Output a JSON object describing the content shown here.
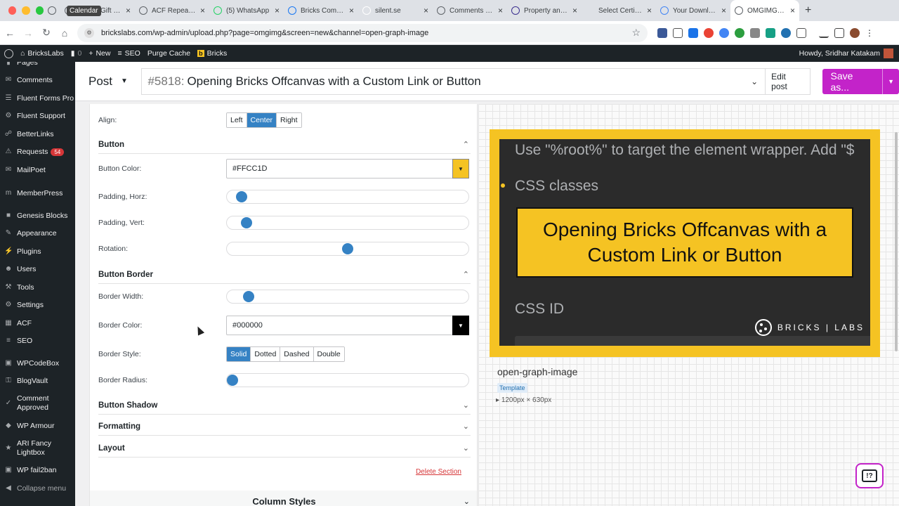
{
  "browser": {
    "tooltip": "Calendar",
    "tabs": [
      {
        "title": "",
        "width": 24
      },
      {
        "title": "Your E-Gift Car",
        "width": 106
      },
      {
        "title": "ACF Repeater F",
        "width": 106
      },
      {
        "title": "(5) WhatsApp",
        "width": 106
      },
      {
        "title": "Bricks Commun",
        "width": 106
      },
      {
        "title": "silent.se",
        "width": 106
      },
      {
        "title": "Comments ‹ Bri",
        "width": 106
      },
      {
        "title": "Property and p",
        "width": 106
      },
      {
        "title": "Select Certifica",
        "width": 106
      },
      {
        "title": "Your Download",
        "width": 106
      },
      {
        "title": "OMGIMG ‹ Bric",
        "width": 98
      }
    ],
    "url": "brickslabs.com/wp-admin/upload.php?page=omgimg&screen=new&channel=open-graph-image"
  },
  "adminbar": {
    "site": "BricksLabs",
    "comments": "0",
    "new": "New",
    "seo": "SEO",
    "purge": "Purge Cache",
    "bricks": "Bricks",
    "howdy": "Howdy, Sridhar Katakam"
  },
  "sidebar": {
    "items": [
      {
        "label": "Pages"
      },
      {
        "label": "Comments"
      },
      {
        "label": "Fluent Forms Pro"
      },
      {
        "label": "Fluent Support"
      },
      {
        "label": "BetterLinks"
      },
      {
        "label": "Requests",
        "badge": "54"
      },
      {
        "label": "MailPoet"
      },
      {
        "label": "MemberPress"
      },
      {
        "label": "Genesis Blocks"
      },
      {
        "label": "Appearance"
      },
      {
        "label": "Plugins"
      },
      {
        "label": "Users"
      },
      {
        "label": "Tools"
      },
      {
        "label": "Settings"
      },
      {
        "label": "ACF"
      },
      {
        "label": "SEO"
      },
      {
        "label": "WPCodeBox"
      },
      {
        "label": "BlogVault"
      },
      {
        "label": "Comment Approved"
      },
      {
        "label": "WP Armour"
      },
      {
        "label": "ARI Fancy Lightbox"
      },
      {
        "label": "WP fail2ban"
      },
      {
        "label": "Collapse menu"
      }
    ]
  },
  "header": {
    "post_type": "Post",
    "post_number": "#5818:",
    "post_title": "Opening Bricks Offcanvas with a Custom Link or Button",
    "edit_post": "Edit post",
    "save_as": "Save as..."
  },
  "settings": {
    "align_label": "Align:",
    "align_options": [
      "Left",
      "Center",
      "Right"
    ],
    "align_selected": "Center",
    "button_section": "Button",
    "button_color_label": "Button Color:",
    "button_color_value": "#FFCC1D",
    "padding_horz_label": "Padding, Horz:",
    "padding_horz_level": 0.04,
    "padding_vert_label": "Padding, Vert:",
    "padding_vert_level": 0.06,
    "rotation_label": "Rotation:",
    "rotation_level": 0.5,
    "border_section": "Button Border",
    "border_width_label": "Border Width:",
    "border_width_level": 0.07,
    "border_color_label": "Border Color:",
    "border_color_value": "#000000",
    "border_style_label": "Border Style:",
    "border_style_options": [
      "Solid",
      "Dotted",
      "Dashed",
      "Double"
    ],
    "border_style_selected": "Solid",
    "border_radius_label": "Border Radius:",
    "border_radius_level": 0,
    "shadow_section": "Button Shadow",
    "formatting_section": "Formatting",
    "layout_section": "Layout",
    "delete_section": "Delete Section",
    "column_styles": "Column Styles"
  },
  "preview": {
    "line1": "Use \"%root%\" to target the element wrapper. Add \"$",
    "line2": "CSS classes",
    "line3": "CSS ID",
    "callout": "Opening Bricks Offcanvas with a Custom Link or Button",
    "logo": "BRICKS | LABS",
    "name": "open-graph-image",
    "badge": "Template",
    "dimensions": "1200px × 630px"
  },
  "colors": {
    "accent": "#c323c9",
    "blue": "#3582c4",
    "yellow": "#f5c323"
  }
}
